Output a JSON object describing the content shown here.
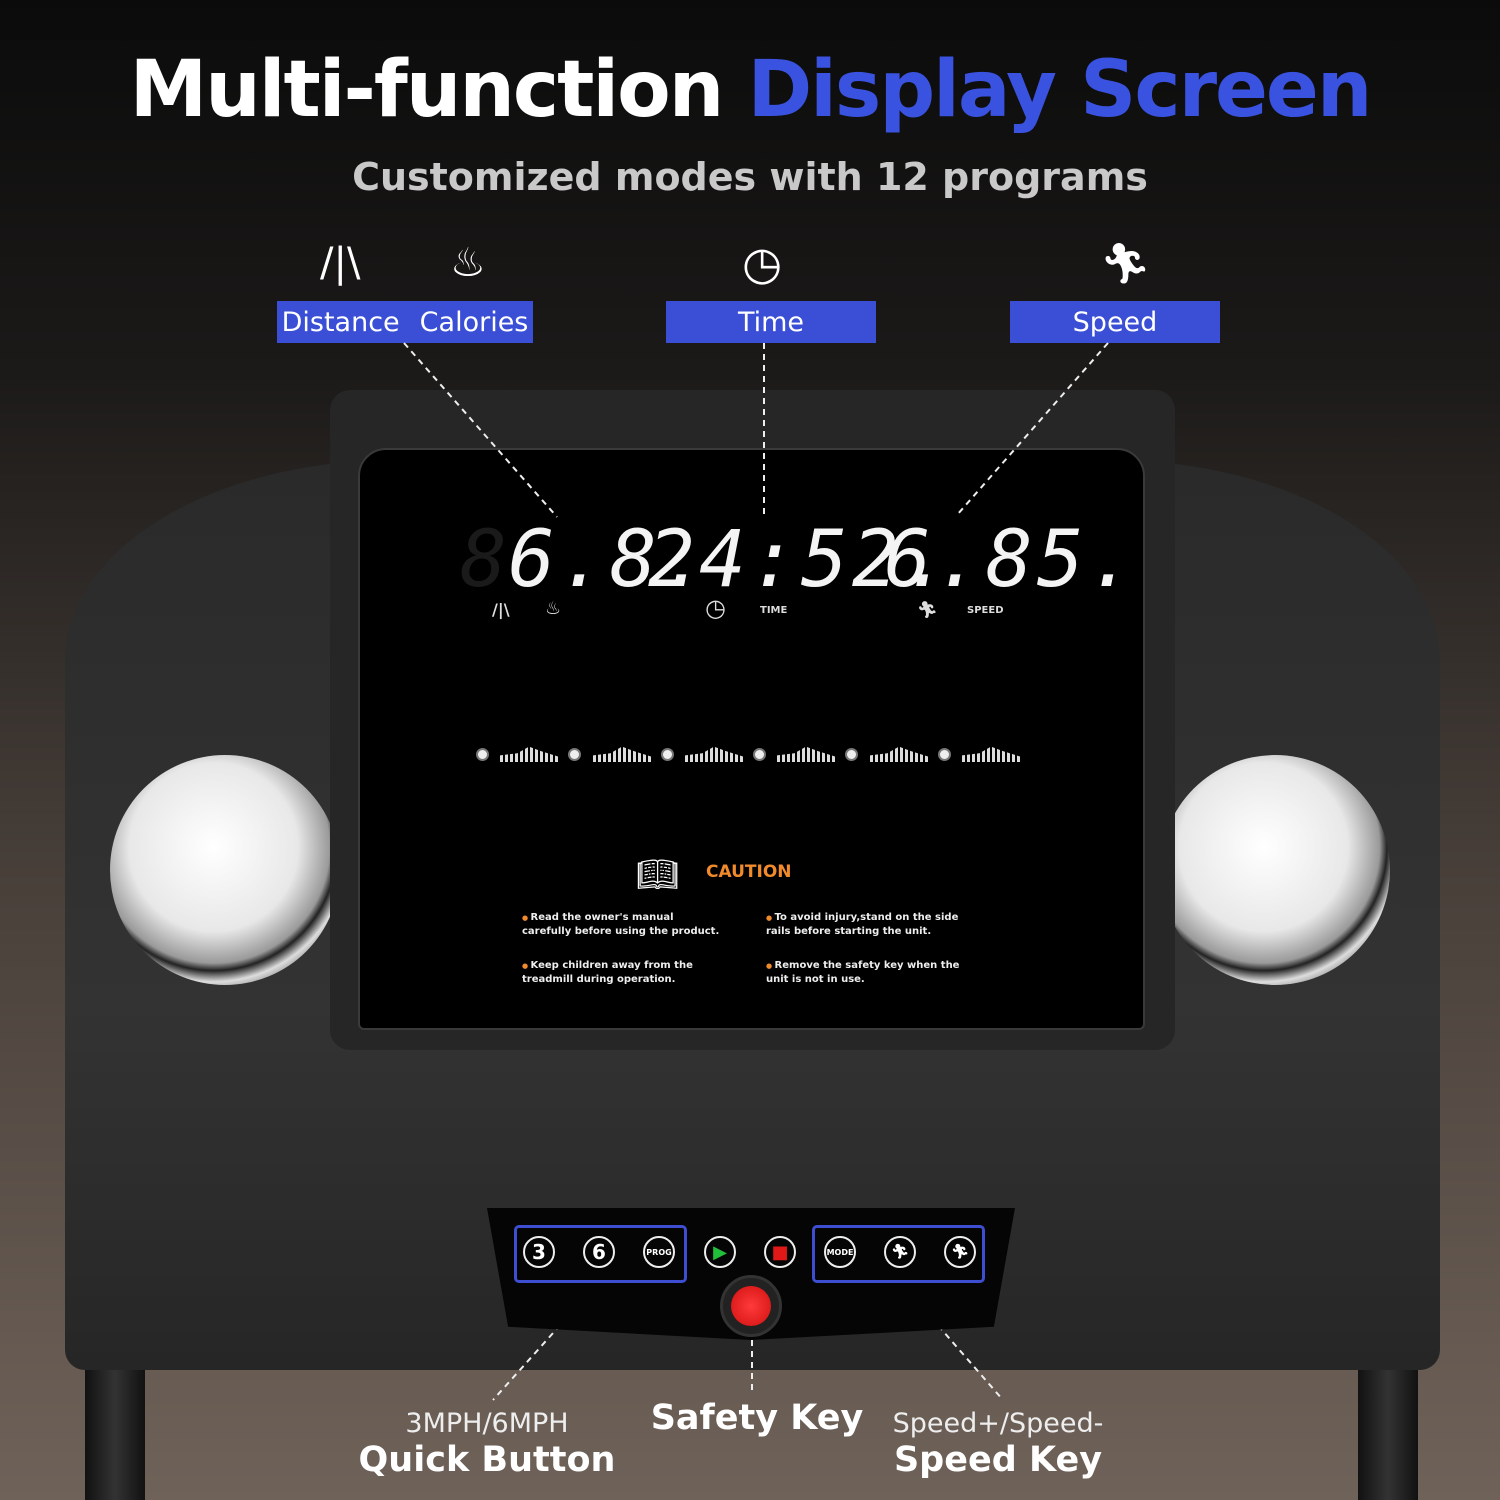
{
  "header": {
    "title_white": "Multi-function",
    "title_blue": "Display Screen",
    "subtitle": "Customized modes with 12 programs",
    "accent_color": "#3a4fd6"
  },
  "labels": {
    "distance": "Distance",
    "calories": "Calories",
    "time": "Time",
    "speed": "Speed"
  },
  "icons": {
    "distance": "road-icon",
    "calories": "flame-icon",
    "time": "clock-icon",
    "speed": "runner-icon"
  },
  "display": {
    "distance_calories": "6.8.",
    "time": "24:52.",
    "speed": "6.85.",
    "time_label": "TIME",
    "speed_label": "SPEED"
  },
  "caution": {
    "title": "CAUTION",
    "notes": [
      "Read the owner's manual carefully before using the product.",
      "To avoid injury,stand on the side rails before starting the unit.",
      "Keep children away from the treadmill during operation.",
      "Remove the safety key when the unit is not in use."
    ],
    "color": "#f08a2a"
  },
  "buttons": {
    "quick3": "3",
    "quick6": "6",
    "prog": "PROG",
    "mode": "MODE"
  },
  "callouts": {
    "quick_sub": "3MPH/6MPH",
    "quick_title": "Quick Button",
    "safety_title": "Safety Key",
    "speed_sub": "Speed+/Speed-",
    "speed_title": "Speed Key"
  }
}
